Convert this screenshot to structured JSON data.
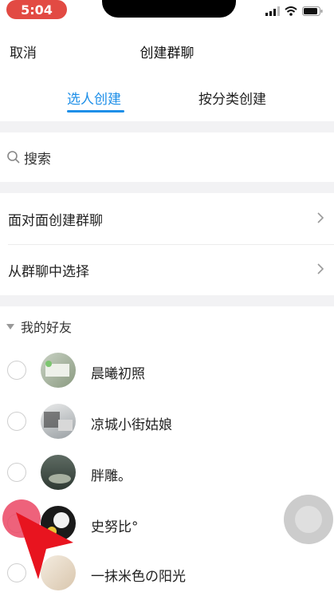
{
  "status_bar": {
    "time": "5:04"
  },
  "header": {
    "cancel": "取消",
    "title": "创建群聊"
  },
  "tabs": [
    {
      "label": "选人创建",
      "active": true
    },
    {
      "label": "按分类创建",
      "active": false
    }
  ],
  "search": {
    "placeholder": "搜索"
  },
  "entries": [
    {
      "label": "面对面创建群聊"
    },
    {
      "label": "从群聊中选择"
    }
  ],
  "friends_section": {
    "title": "我的好友"
  },
  "friends": [
    {
      "name": "晨曦初照"
    },
    {
      "name": "凉城小街姑娘"
    },
    {
      "name": "胖雕。"
    },
    {
      "name": "史努比°"
    },
    {
      "name": "一抹米色の阳光"
    }
  ],
  "colors": {
    "accent": "#1e8fe8",
    "time_pill": "#e24a43",
    "touch_overlay": "#eb4664"
  },
  "icons": [
    "signal-icon",
    "wifi-icon",
    "battery-icon",
    "search-icon",
    "chevron-right-icon",
    "collapse-triangle-icon",
    "assistive-touch-icon",
    "touch-indicator-icon",
    "pointer-arrow-icon"
  ]
}
